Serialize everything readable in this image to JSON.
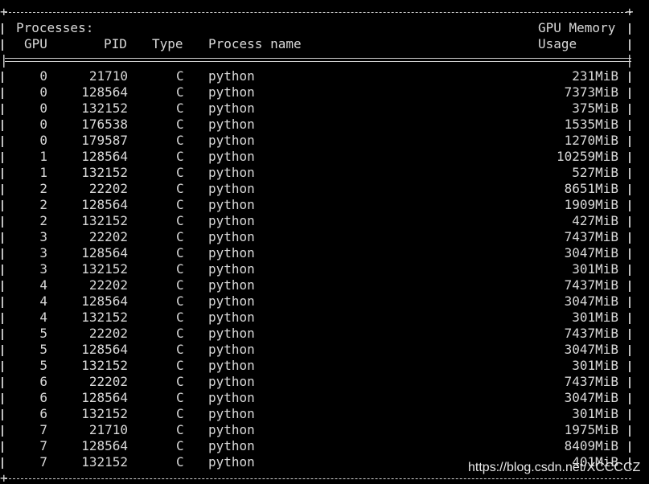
{
  "header": {
    "section_title": "Processes:",
    "col_gpu": "GPU",
    "col_pid": "PID",
    "col_type": "Type",
    "col_name": "Process name",
    "col_mem_1": "GPU Memory",
    "col_mem_2": "Usage"
  },
  "rows": [
    {
      "gpu": "0",
      "pid": "21710",
      "type": "C",
      "name": "python",
      "mem": "231MiB"
    },
    {
      "gpu": "0",
      "pid": "128564",
      "type": "C",
      "name": "python",
      "mem": "7373MiB"
    },
    {
      "gpu": "0",
      "pid": "132152",
      "type": "C",
      "name": "python",
      "mem": "375MiB"
    },
    {
      "gpu": "0",
      "pid": "176538",
      "type": "C",
      "name": "python",
      "mem": "1535MiB"
    },
    {
      "gpu": "0",
      "pid": "179587",
      "type": "C",
      "name": "python",
      "mem": "1270MiB"
    },
    {
      "gpu": "1",
      "pid": "128564",
      "type": "C",
      "name": "python",
      "mem": "10259MiB"
    },
    {
      "gpu": "1",
      "pid": "132152",
      "type": "C",
      "name": "python",
      "mem": "527MiB"
    },
    {
      "gpu": "2",
      "pid": "22202",
      "type": "C",
      "name": "python",
      "mem": "8651MiB"
    },
    {
      "gpu": "2",
      "pid": "128564",
      "type": "C",
      "name": "python",
      "mem": "1909MiB"
    },
    {
      "gpu": "2",
      "pid": "132152",
      "type": "C",
      "name": "python",
      "mem": "427MiB"
    },
    {
      "gpu": "3",
      "pid": "22202",
      "type": "C",
      "name": "python",
      "mem": "7437MiB"
    },
    {
      "gpu": "3",
      "pid": "128564",
      "type": "C",
      "name": "python",
      "mem": "3047MiB"
    },
    {
      "gpu": "3",
      "pid": "132152",
      "type": "C",
      "name": "python",
      "mem": "301MiB"
    },
    {
      "gpu": "4",
      "pid": "22202",
      "type": "C",
      "name": "python",
      "mem": "7437MiB"
    },
    {
      "gpu": "4",
      "pid": "128564",
      "type": "C",
      "name": "python",
      "mem": "3047MiB"
    },
    {
      "gpu": "4",
      "pid": "132152",
      "type": "C",
      "name": "python",
      "mem": "301MiB"
    },
    {
      "gpu": "5",
      "pid": "22202",
      "type": "C",
      "name": "python",
      "mem": "7437MiB"
    },
    {
      "gpu": "5",
      "pid": "128564",
      "type": "C",
      "name": "python",
      "mem": "3047MiB"
    },
    {
      "gpu": "5",
      "pid": "132152",
      "type": "C",
      "name": "python",
      "mem": "301MiB"
    },
    {
      "gpu": "6",
      "pid": "22202",
      "type": "C",
      "name": "python",
      "mem": "7437MiB"
    },
    {
      "gpu": "6",
      "pid": "128564",
      "type": "C",
      "name": "python",
      "mem": "3047MiB"
    },
    {
      "gpu": "6",
      "pid": "132152",
      "type": "C",
      "name": "python",
      "mem": "301MiB"
    },
    {
      "gpu": "7",
      "pid": "21710",
      "type": "C",
      "name": "python",
      "mem": "1975MiB"
    },
    {
      "gpu": "7",
      "pid": "128564",
      "type": "C",
      "name": "python",
      "mem": "8409MiB"
    },
    {
      "gpu": "7",
      "pid": "132152",
      "type": "C",
      "name": "python",
      "mem": "401MiB"
    }
  ],
  "watermark": "https://blog.csdn.net/XCCCCZ"
}
